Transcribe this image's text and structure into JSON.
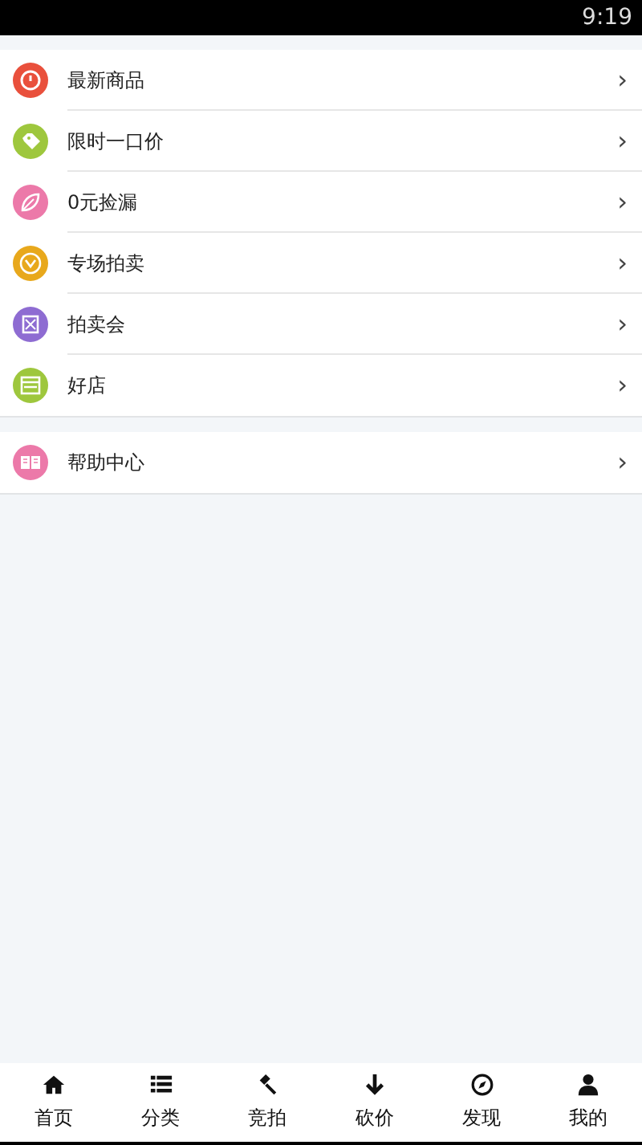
{
  "status_bar": {
    "time": "9:19"
  },
  "groups": [
    {
      "items": [
        {
          "label": "最新商品",
          "color": "#e9503c"
        },
        {
          "label": "限时一口价",
          "color": "#9ec73d"
        },
        {
          "label": "0元捡漏",
          "color": "#ec79a9"
        },
        {
          "label": "专场拍卖",
          "color": "#e8a81c"
        },
        {
          "label": "拍卖会",
          "color": "#8e6cd2"
        },
        {
          "label": "好店",
          "color": "#9ec73d"
        }
      ]
    },
    {
      "items": [
        {
          "label": "帮助中心",
          "color": "#ec79a9"
        }
      ]
    }
  ],
  "tab_bar": [
    {
      "label": "首页"
    },
    {
      "label": "分类"
    },
    {
      "label": "竞拍"
    },
    {
      "label": "砍价"
    },
    {
      "label": "发现"
    },
    {
      "label": "我的"
    }
  ],
  "chevron": "›"
}
